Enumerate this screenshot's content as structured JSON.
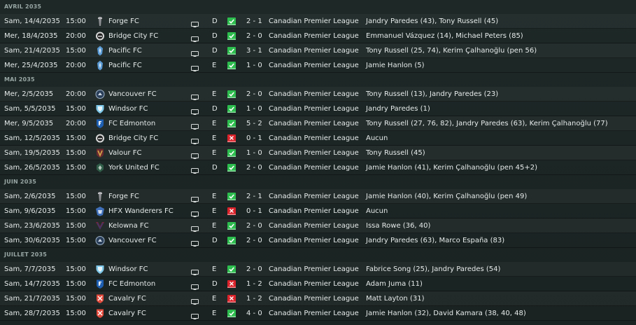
{
  "colors": {
    "background": "#1b2423",
    "win": "#2dbd4e",
    "loss": "#d9222a",
    "text": "#e6ebea",
    "month_header": "#98a6a4"
  },
  "months": [
    {
      "label": "AVRIL 2035",
      "matches": [
        {
          "date": "Sam, 14/4/2035",
          "time": "15:00",
          "crest": "forge-crest",
          "opponent": "Forge FC",
          "venue": "D",
          "result": "win",
          "score": "2 - 1",
          "competition": "Canadian Premier League",
          "scorers": "Jandry Paredes (43), Tony Russell (45)"
        },
        {
          "date": "Mer, 18/4/2035",
          "time": "20:00",
          "crest": "bridge-city-crest",
          "opponent": "Bridge City FC",
          "venue": "D",
          "result": "win",
          "score": "2 - 0",
          "competition": "Canadian Premier League",
          "scorers": "Emmanuel Vázquez (14), Michael Peters (85)"
        },
        {
          "date": "Sam, 21/4/2035",
          "time": "15:00",
          "crest": "pacific-crest",
          "opponent": "Pacific FC",
          "venue": "D",
          "result": "win",
          "score": "3 - 1",
          "competition": "Canadian Premier League",
          "scorers": "Tony Russell (25, 74), Kerim Çalhanoğlu (pen 56)"
        },
        {
          "date": "Mer, 25/4/2035",
          "time": "20:00",
          "crest": "pacific-crest",
          "opponent": "Pacific FC",
          "venue": "E",
          "result": "win",
          "score": "1 - 0",
          "competition": "Canadian Premier League",
          "scorers": "Jamie Hanlon (5)"
        }
      ]
    },
    {
      "label": "MAI 2035",
      "matches": [
        {
          "date": "Mer, 2/5/2035",
          "time": "20:00",
          "crest": "vancouver-crest",
          "opponent": "Vancouver FC",
          "venue": "E",
          "result": "win",
          "score": "2 - 0",
          "competition": "Canadian Premier League",
          "scorers": "Tony Russell (13), Jandry Paredes (23)"
        },
        {
          "date": "Sam, 5/5/2035",
          "time": "15:00",
          "crest": "windsor-crest",
          "opponent": "Windsor FC",
          "venue": "D",
          "result": "win",
          "score": "1 - 0",
          "competition": "Canadian Premier League",
          "scorers": "Jandry Paredes (1)"
        },
        {
          "date": "Mer, 9/5/2035",
          "time": "20:00",
          "crest": "edmonton-crest",
          "opponent": "FC Edmonton",
          "venue": "E",
          "result": "win",
          "score": "5 - 2",
          "competition": "Canadian Premier League",
          "scorers": "Tony Russell (27, 76, 82), Jandry Paredes (63), Kerim Çalhanoğlu (77)"
        },
        {
          "date": "Sam, 12/5/2035",
          "time": "15:00",
          "crest": "bridge-city-crest",
          "opponent": "Bridge City FC",
          "venue": "E",
          "result": "loss",
          "score": "0 - 1",
          "competition": "Canadian Premier League",
          "scorers": "Aucun"
        },
        {
          "date": "Sam, 19/5/2035",
          "time": "15:00",
          "crest": "valour-crest",
          "opponent": "Valour FC",
          "venue": "E",
          "result": "win",
          "score": "1 - 0",
          "competition": "Canadian Premier League",
          "scorers": "Tony Russell (45)"
        },
        {
          "date": "Sam, 26/5/2035",
          "time": "15:00",
          "crest": "york-united-crest",
          "opponent": "York United FC",
          "venue": "D",
          "result": "win",
          "score": "2 - 0",
          "competition": "Canadian Premier League",
          "scorers": "Jamie Hanlon (41), Kerim Çalhanoğlu (pen 45+2)"
        }
      ]
    },
    {
      "label": "JUIN 2035",
      "matches": [
        {
          "date": "Sam, 2/6/2035",
          "time": "15:00",
          "crest": "forge-crest",
          "opponent": "Forge FC",
          "venue": "E",
          "result": "win",
          "score": "2 - 1",
          "competition": "Canadian Premier League",
          "scorers": "Jamie Hanlon (40), Kerim Çalhanoğlu (pen 49)"
        },
        {
          "date": "Sam, 9/6/2035",
          "time": "15:00",
          "crest": "hfx-wanderers-crest",
          "opponent": "HFX Wanderers FC",
          "venue": "E",
          "result": "loss",
          "score": "0 - 1",
          "competition": "Canadian Premier League",
          "scorers": "Aucun"
        },
        {
          "date": "Sam, 23/6/2035",
          "time": "15:00",
          "crest": "kelowna-crest",
          "opponent": "Kelowna FC",
          "venue": "E",
          "result": "win",
          "score": "2 - 0",
          "competition": "Canadian Premier League",
          "scorers": "Issa Rowe (36, 40)"
        },
        {
          "date": "Sam, 30/6/2035",
          "time": "15:00",
          "crest": "vancouver-crest",
          "opponent": "Vancouver FC",
          "venue": "D",
          "result": "win",
          "score": "2 - 0",
          "competition": "Canadian Premier League",
          "scorers": "Jandry Paredes (63), Marco España (83)"
        }
      ]
    },
    {
      "label": "JUILLET 2035",
      "matches": [
        {
          "date": "Sam, 7/7/2035",
          "time": "15:00",
          "crest": "windsor-crest",
          "opponent": "Windsor FC",
          "venue": "E",
          "result": "win",
          "score": "2 - 0",
          "competition": "Canadian Premier League",
          "scorers": "Fabrice Song (25), Jandry Paredes (54)"
        },
        {
          "date": "Sam, 14/7/2035",
          "time": "15:00",
          "crest": "edmonton-crest",
          "opponent": "FC Edmonton",
          "venue": "D",
          "result": "loss",
          "score": "1 - 2",
          "competition": "Canadian Premier League",
          "scorers": "Adam Juma (11)"
        },
        {
          "date": "Sam, 21/7/2035",
          "time": "15:00",
          "crest": "cavalry-crest",
          "opponent": "Cavalry FC",
          "venue": "E",
          "result": "loss",
          "score": "1 - 2",
          "competition": "Canadian Premier League",
          "scorers": "Matt Layton (31)"
        },
        {
          "date": "Sam, 28/7/2035",
          "time": "15:00",
          "crest": "cavalry-crest",
          "opponent": "Cavalry FC",
          "venue": "E",
          "result": "win",
          "score": "4 - 0",
          "competition": "Canadian Premier League",
          "scorers": "Jamie Hanlon (32), David Kamara (38, 40, 48)"
        }
      ]
    }
  ]
}
